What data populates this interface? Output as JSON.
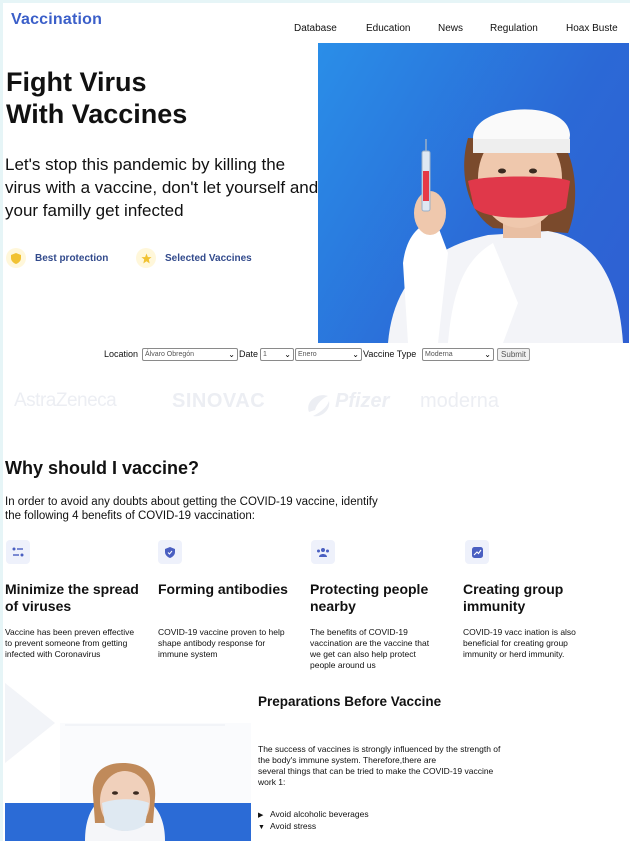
{
  "brand": "Vaccination",
  "nav": [
    "Database",
    "Education",
    "News",
    "Regulation",
    "Hoax Buste"
  ],
  "hero": {
    "title_line1": "Fight Virus",
    "title_line2": "With Vaccines",
    "subtitle": "Let's stop this pandemic by killing the virus with a vaccine, don't let yourself and your familly get infected",
    "features": [
      {
        "label": "Best protection",
        "icon": "shield-icon"
      },
      {
        "label": "Selected Vaccines",
        "icon": "star-icon"
      }
    ]
  },
  "search_form": {
    "location_label": "Location",
    "location_value": "Álvaro Obregón",
    "date_label": "Date",
    "day_value": "1",
    "month_value": "Enero",
    "vaccine_type_label": "Vaccine Type",
    "vaccine_type_value": "Moderna",
    "submit_label": "Submit"
  },
  "partner_logos": [
    "AstraZeneca",
    "SINOVAC",
    "Pfizer",
    "moderna"
  ],
  "why": {
    "title": "Why should I vaccine?",
    "intro": "In order to avoid any doubts about getting the COVID-19 vaccine, identify the following 4 benefits of COVID-19 vaccination:",
    "benefits": [
      {
        "title": "Minimize the spread of viruses",
        "desc": "Vaccine has been preven effective to prevent someone from getting infected with Coronavirus",
        "icon": "sliders-icon"
      },
      {
        "title": "Forming antibodies",
        "desc": "COVID-19 vaccine proven to help shape antibody response for immune system",
        "icon": "shield-icon"
      },
      {
        "title": "Protecting people nearby",
        "desc": "The benefits of COVID-19 vaccination are the vaccine that we get can also help protect people around us",
        "icon": "people-icon"
      },
      {
        "title": "Creating group immunity",
        "desc": "COVID-19 vacc ination is also beneficial for creating group immunity or herd immunity.",
        "icon": "chart-icon"
      }
    ]
  },
  "preparations": {
    "title": "Preparations Before Vaccine",
    "text_1": "The success of vaccines is strongly influenced by the strength of the body's immune system. Therefore,there are",
    "text_2": "several things that can be tried to make the COVID-19 vaccine work 1:",
    "items": [
      {
        "label": "Avoid alcoholic beverages",
        "expanded": false
      },
      {
        "label": "Avoid stress",
        "expanded": true
      }
    ]
  }
}
